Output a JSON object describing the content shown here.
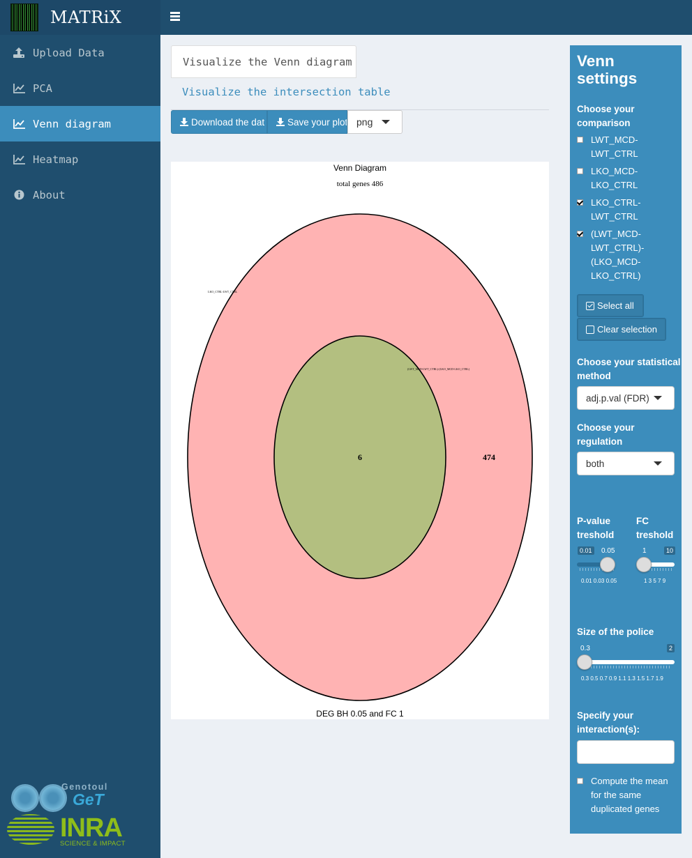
{
  "app": {
    "title": "MATRiX"
  },
  "sidebar": {
    "items": [
      {
        "label": "Upload Data",
        "icon": "upload-icon"
      },
      {
        "label": "PCA",
        "icon": "line-chart-icon"
      },
      {
        "label": "Venn diagram",
        "icon": "line-chart-icon",
        "active": true
      },
      {
        "label": "Heatmap",
        "icon": "line-chart-icon"
      },
      {
        "label": "About",
        "icon": "info-circle-icon"
      }
    ],
    "sponsors": {
      "genotoul": "Genotoul",
      "get": "GeT",
      "inra": "INRA",
      "inra_tagline": "SCIENCE & IMPACT"
    }
  },
  "tabs": [
    {
      "label": "Visualize the Venn diagram",
      "active": true
    },
    {
      "label": "Visualize the intersection table",
      "active": false
    }
  ],
  "toolbar": {
    "download_label": "Download the dat",
    "save_label": "Save your plot",
    "format_value": "png"
  },
  "plot": {
    "title": "Venn Diagram",
    "subtitle": "total genes 486",
    "footer": "DEG BH 0.05 and FC 1",
    "outer_label": "LKO_CTRL-LWT_CTRL",
    "inner_label": "(LWT_MCD-LWT_CTRL)-(LKO_MCD-LKO_CTRL)",
    "outer_count": "474",
    "inner_count": "6",
    "outer_color": "#ffb3b3",
    "inner_color": "#b3bf80"
  },
  "settings": {
    "title_line1": "Venn",
    "title_line2": "settings",
    "comparison_label_line1": "Choose your",
    "comparison_label_line2": "comparison",
    "comparisons": [
      {
        "lines": [
          "LWT_MCD-",
          "LWT_CTRL"
        ],
        "checked": false
      },
      {
        "lines": [
          "LKO_MCD-",
          "LKO_CTRL"
        ],
        "checked": false
      },
      {
        "lines": [
          "LKO_CTRL-",
          "LWT_CTRL"
        ],
        "checked": true
      },
      {
        "lines": [
          "(LWT_MCD-",
          "LWT_CTRL)-",
          "(LKO_MCD-",
          "LKO_CTRL)"
        ],
        "checked": true
      }
    ],
    "select_all": "Select all",
    "clear_selection": "Clear selection",
    "method_label_line1": "Choose your statistical",
    "method_label_line2": "method",
    "method_value": "adj.p.val (FDR)",
    "regulation_label_line1": "Choose your",
    "regulation_label_line2": "regulation",
    "regulation_value": "both",
    "pvalue_label_line1": "P-value",
    "pvalue_label_line2": "treshold",
    "pvalue_min": "0.01",
    "pvalue_max": "0.05",
    "pvalue_value": "0.05",
    "pvalue_ticks": "0.01 0.03 0.05",
    "fc_label_line1": "FC",
    "fc_label_line2": "treshold",
    "fc_min": "1",
    "fc_max": "10",
    "fc_value": "1",
    "fc_ticks": "1 3 5 7 9",
    "police_label": "Size of the police",
    "police_min": "0.3",
    "police_max": "2",
    "police_value": "0.3",
    "police_ticks": "0.3 0.5 0.7 0.9 1.1 1.3 1.5 1.7 1.9",
    "interaction_label_line1": "Specify your",
    "interaction_label_line2": "interaction(s):",
    "mean_label_lines": [
      "Compute the mean",
      "for the same",
      "duplicated genes"
    ]
  }
}
